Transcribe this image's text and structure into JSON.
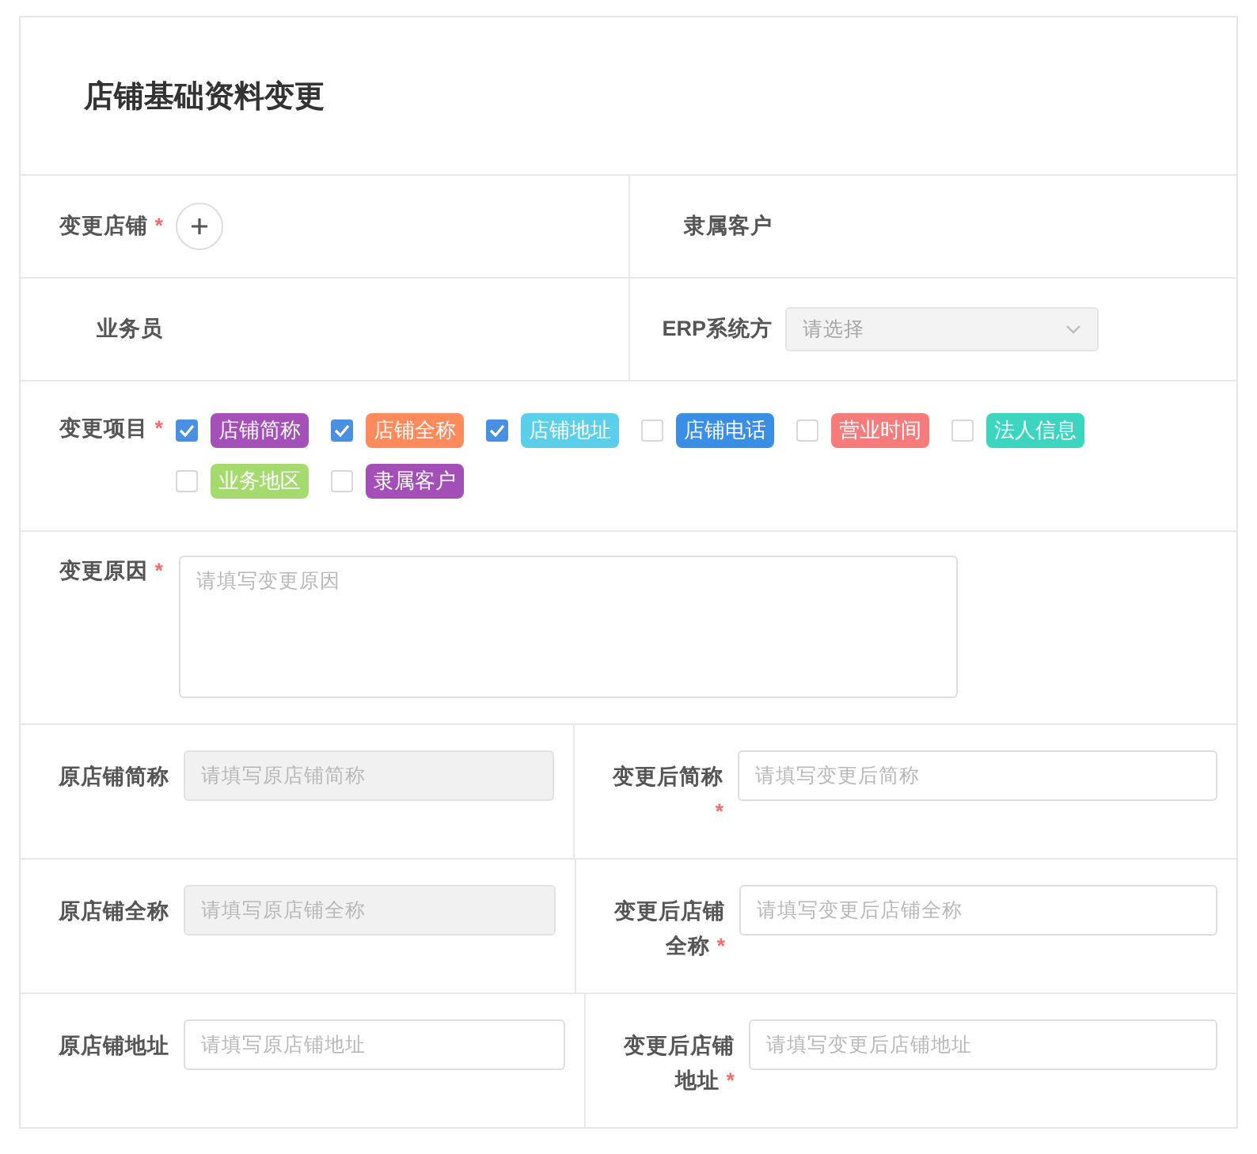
{
  "title": "店铺基础资料变更",
  "top_rows": [
    [
      {
        "kind": "add",
        "label": "变更店铺",
        "required_mark": "*"
      },
      {
        "kind": "text",
        "label": "隶属客户"
      }
    ],
    [
      {
        "kind": "text",
        "label": "业务员"
      },
      {
        "kind": "select",
        "label": "ERP系统方",
        "placeholder": "请选择",
        "disabled": true
      }
    ]
  ],
  "items": {
    "label": "变更项目",
    "required_mark": "*",
    "options": [
      {
        "label": "店铺简称",
        "checked": true,
        "color": "#a550b9"
      },
      {
        "label": "店铺全称",
        "checked": true,
        "color": "#ff8a5b"
      },
      {
        "label": "店铺地址",
        "checked": true,
        "color": "#5bcfea"
      },
      {
        "label": "店铺电话",
        "checked": false,
        "color": "#3a8ee6"
      },
      {
        "label": "营业时间",
        "checked": false,
        "color": "#f87b7b"
      },
      {
        "label": "法人信息",
        "checked": false,
        "color": "#3cd5bf"
      },
      {
        "label": "业务地区",
        "checked": false,
        "color": "#a5db6e"
      },
      {
        "label": "隶属客户",
        "checked": false,
        "color": "#a44fb8"
      }
    ]
  },
  "reason": {
    "label": "变更原因",
    "required_mark": "*",
    "placeholder": "请填写变更原因"
  },
  "pairs": [
    [
      {
        "label": "原店铺简称",
        "placeholder": "请填写原店铺简称",
        "disabled": true
      },
      {
        "label": "变更后简称",
        "required_mark": "*",
        "placeholder": "请填写变更后简称",
        "disabled": false
      }
    ],
    [
      {
        "label": "原店铺全称",
        "placeholder": "请填写原店铺全称",
        "disabled": true
      },
      {
        "label": "变更后店铺全称",
        "required_mark": "*",
        "placeholder": "请填写变更后店铺全称",
        "disabled": false
      }
    ],
    [
      {
        "label": "原店铺地址",
        "placeholder": "请填写原店铺地址",
        "disabled": false
      },
      {
        "label": "变更后店铺地址",
        "required_mark": "*",
        "placeholder": "请填写变更后店铺地址",
        "disabled": false
      }
    ]
  ]
}
